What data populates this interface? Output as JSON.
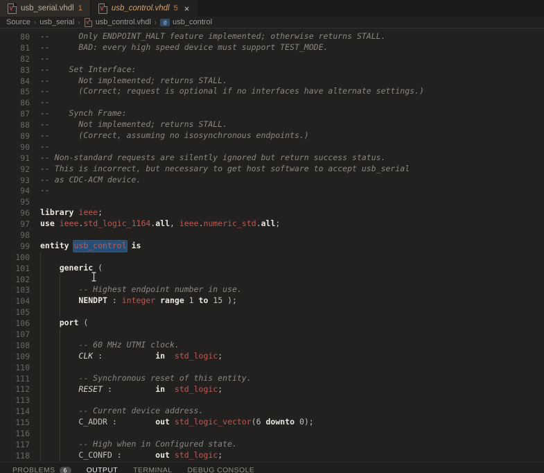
{
  "tabs": [
    {
      "label": "usb_serial.vhdl",
      "problem_count": "1",
      "active": false
    },
    {
      "label": "usb_control.vhdl",
      "problem_count": "5",
      "active": true,
      "close_glyph": "×"
    }
  ],
  "breadcrumb": {
    "items": [
      {
        "label": "Source"
      },
      {
        "label": "usb_serial"
      },
      {
        "label": "usb_control.vhdl",
        "icon": "vhdl-file-icon"
      },
      {
        "label": "usb_control",
        "icon": "symbol-module-icon",
        "icon_glyph": "@"
      }
    ],
    "separator": "›"
  },
  "editor": {
    "language": "vhdl",
    "selected_word": "usb_control",
    "lines": [
      {
        "n": "80",
        "g": [],
        "t": [
          [
            "cm",
            "--      Only ENDPOINT_HALT feature implemented; otherwise returns STALL."
          ]
        ]
      },
      {
        "n": "81",
        "g": [],
        "t": [
          [
            "cm",
            "--      BAD: every high speed device must support TEST_MODE."
          ]
        ]
      },
      {
        "n": "82",
        "g": [],
        "t": [
          [
            "cm",
            "--"
          ]
        ]
      },
      {
        "n": "83",
        "g": [],
        "t": [
          [
            "cm",
            "--    Set Interface:"
          ]
        ]
      },
      {
        "n": "84",
        "g": [],
        "t": [
          [
            "cm",
            "--      Not implemented; returns STALL."
          ]
        ]
      },
      {
        "n": "85",
        "g": [],
        "t": [
          [
            "cm",
            "--      (Correct; request is optional if no interfaces have alternate settings.)"
          ]
        ]
      },
      {
        "n": "86",
        "g": [],
        "t": [
          [
            "cm",
            "--"
          ]
        ]
      },
      {
        "n": "87",
        "g": [],
        "t": [
          [
            "cm",
            "--    Synch Frame:"
          ]
        ]
      },
      {
        "n": "88",
        "g": [],
        "t": [
          [
            "cm",
            "--      Not implemented; returns STALL."
          ]
        ]
      },
      {
        "n": "89",
        "g": [],
        "t": [
          [
            "cm",
            "--      (Correct, assuming no isosynchronous endpoints.)"
          ]
        ]
      },
      {
        "n": "90",
        "g": [],
        "t": [
          [
            "cm",
            "--"
          ]
        ]
      },
      {
        "n": "91",
        "g": [],
        "t": [
          [
            "cm",
            "-- Non-standard requests are silently ignored but return success status."
          ]
        ]
      },
      {
        "n": "92",
        "g": [],
        "t": [
          [
            "cm",
            "-- This is incorrect, but necessary to get host software to accept usb_serial"
          ]
        ]
      },
      {
        "n": "93",
        "g": [],
        "t": [
          [
            "cm",
            "-- as CDC-ACM device."
          ]
        ]
      },
      {
        "n": "94",
        "g": [],
        "t": [
          [
            "cm",
            "--"
          ]
        ]
      },
      {
        "n": "95",
        "g": [],
        "t": []
      },
      {
        "n": "96",
        "g": [],
        "t": [
          [
            "kw",
            "library"
          ],
          [
            "pl",
            " "
          ],
          [
            "ty",
            "ieee"
          ],
          [
            "pl",
            ";"
          ]
        ]
      },
      {
        "n": "97",
        "g": [],
        "t": [
          [
            "kw",
            "use"
          ],
          [
            "pl",
            " "
          ],
          [
            "ty",
            "ieee"
          ],
          [
            "pl",
            "."
          ],
          [
            "ty",
            "std_logic_1164"
          ],
          [
            "pl",
            "."
          ],
          [
            "kw",
            "all"
          ],
          [
            "pl",
            ", "
          ],
          [
            "ty",
            "ieee"
          ],
          [
            "pl",
            "."
          ],
          [
            "ty",
            "numeric_std"
          ],
          [
            "pl",
            "."
          ],
          [
            "kw",
            "all"
          ],
          [
            "pl",
            ";"
          ]
        ]
      },
      {
        "n": "98",
        "g": [],
        "t": []
      },
      {
        "n": "99",
        "g": [],
        "t": [
          [
            "kw",
            "entity"
          ],
          [
            "pl",
            " "
          ],
          [
            "sel",
            "usb_control"
          ],
          [
            "pl",
            " "
          ],
          [
            "kw",
            "is"
          ]
        ]
      },
      {
        "n": "100",
        "g": [
          0
        ],
        "t": []
      },
      {
        "n": "101",
        "g": [
          0
        ],
        "t": [
          [
            "pl",
            "    "
          ],
          [
            "kw",
            "generic"
          ],
          [
            "pl",
            " ("
          ]
        ]
      },
      {
        "n": "102",
        "g": [
          0,
          4
        ],
        "t": []
      },
      {
        "n": "103",
        "g": [
          0,
          4
        ],
        "t": [
          [
            "pl",
            "        "
          ],
          [
            "cm",
            "-- Highest endpoint number in use."
          ]
        ]
      },
      {
        "n": "104",
        "g": [
          0,
          4
        ],
        "t": [
          [
            "pl",
            "        "
          ],
          [
            "kw",
            "NENDPT"
          ],
          [
            "pl",
            " : "
          ],
          [
            "ty",
            "integer"
          ],
          [
            "pl",
            " "
          ],
          [
            "kw",
            "range"
          ],
          [
            "pl",
            " 1 "
          ],
          [
            "kw",
            "to"
          ],
          [
            "pl",
            " 15 );"
          ]
        ]
      },
      {
        "n": "105",
        "g": [
          0,
          4
        ],
        "t": []
      },
      {
        "n": "106",
        "g": [
          0
        ],
        "t": [
          [
            "pl",
            "    "
          ],
          [
            "kw",
            "port"
          ],
          [
            "pl",
            " ("
          ]
        ]
      },
      {
        "n": "107",
        "g": [
          0,
          4
        ],
        "t": []
      },
      {
        "n": "108",
        "g": [
          0,
          4
        ],
        "t": [
          [
            "pl",
            "        "
          ],
          [
            "cm",
            "-- 60 MHz UTMI clock."
          ]
        ]
      },
      {
        "n": "109",
        "g": [
          0,
          4
        ],
        "t": [
          [
            "pl",
            "        "
          ],
          [
            "sig",
            "CLK"
          ],
          [
            "pl",
            " :           "
          ],
          [
            "kw",
            "in"
          ],
          [
            "pl",
            "  "
          ],
          [
            "ty",
            "std_logic"
          ],
          [
            "pl",
            ";"
          ]
        ]
      },
      {
        "n": "110",
        "g": [
          0,
          4
        ],
        "t": []
      },
      {
        "n": "111",
        "g": [
          0,
          4
        ],
        "t": [
          [
            "pl",
            "        "
          ],
          [
            "cm",
            "-- Synchronous reset of this entity."
          ]
        ]
      },
      {
        "n": "112",
        "g": [
          0,
          4
        ],
        "t": [
          [
            "pl",
            "        "
          ],
          [
            "sig",
            "RESET"
          ],
          [
            "pl",
            " :         "
          ],
          [
            "kw",
            "in"
          ],
          [
            "pl",
            "  "
          ],
          [
            "ty",
            "std_logic"
          ],
          [
            "pl",
            ";"
          ]
        ]
      },
      {
        "n": "113",
        "g": [
          0,
          4
        ],
        "t": []
      },
      {
        "n": "114",
        "g": [
          0,
          4
        ],
        "t": [
          [
            "pl",
            "        "
          ],
          [
            "cm",
            "-- Current device address."
          ]
        ]
      },
      {
        "n": "115",
        "g": [
          0,
          4
        ],
        "t": [
          [
            "pl",
            "        "
          ],
          [
            "pl",
            "C_ADDR"
          ],
          [
            "pl",
            " :        "
          ],
          [
            "kw",
            "out"
          ],
          [
            "pl",
            " "
          ],
          [
            "ty",
            "std_logic_vector"
          ],
          [
            "pl",
            "(6 "
          ],
          [
            "kw",
            "downto"
          ],
          [
            "pl",
            " 0);"
          ]
        ]
      },
      {
        "n": "116",
        "g": [
          0,
          4
        ],
        "t": []
      },
      {
        "n": "117",
        "g": [
          0,
          4
        ],
        "t": [
          [
            "pl",
            "        "
          ],
          [
            "cm",
            "-- High when in Configured state."
          ]
        ]
      },
      {
        "n": "118",
        "g": [
          0,
          4
        ],
        "t": [
          [
            "pl",
            "        "
          ],
          [
            "pl",
            "C_CONFD"
          ],
          [
            "pl",
            " :       "
          ],
          [
            "kw",
            "out"
          ],
          [
            "pl",
            " "
          ],
          [
            "ty",
            "std_logic"
          ],
          [
            "pl",
            ";"
          ]
        ]
      }
    ]
  },
  "panel": {
    "tabs": [
      {
        "label": "PROBLEMS",
        "badge": "6",
        "active": false
      },
      {
        "label": "OUTPUT",
        "active": true
      },
      {
        "label": "TERMINAL",
        "active": false
      },
      {
        "label": "DEBUG CONSOLE",
        "active": false
      }
    ]
  },
  "colors": {
    "editor_bg": "#232120",
    "tabstrip_bg": "#1b1a19",
    "inactive_tab_bg": "#2f2b27",
    "problem_count": "#c08146",
    "active_tab_label": "#cfa06f",
    "keyword": "#ece8e1",
    "type_red": "#bd5a50",
    "comment": "#8b867e",
    "selection_bg": "#264f78",
    "line_number": "#6b6761"
  }
}
